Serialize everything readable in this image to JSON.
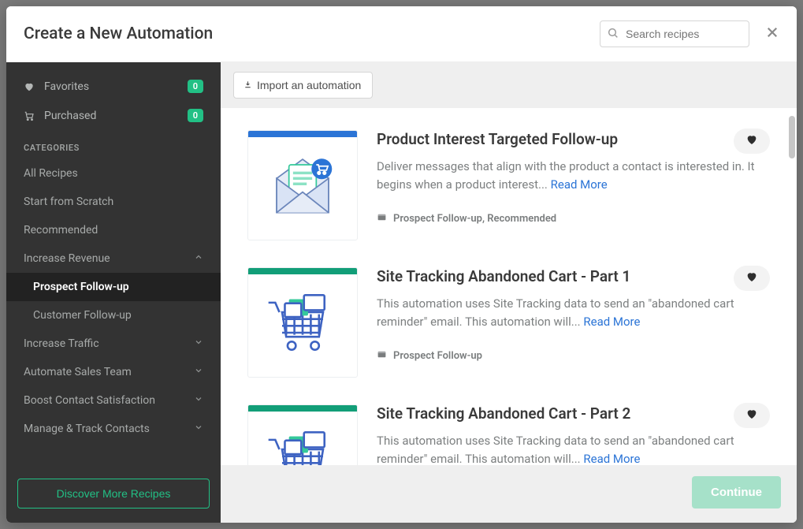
{
  "header": {
    "title": "Create a New Automation",
    "search_placeholder": "Search recipes"
  },
  "sidebar": {
    "top": [
      {
        "label": "Favorites",
        "badge": "0"
      },
      {
        "label": "Purchased",
        "badge": "0"
      }
    ],
    "section_label": "CATEGORIES",
    "categories": [
      {
        "label": "All Recipes"
      },
      {
        "label": "Start from Scratch"
      },
      {
        "label": "Recommended"
      },
      {
        "label": "Increase Revenue",
        "expanded": true,
        "children": [
          {
            "label": "Prospect Follow-up",
            "active": true
          },
          {
            "label": "Customer Follow-up"
          }
        ]
      },
      {
        "label": "Increase Traffic",
        "expandable": true
      },
      {
        "label": "Automate Sales Team",
        "expandable": true
      },
      {
        "label": "Boost Contact Satisfaction",
        "expandable": true
      },
      {
        "label": "Manage & Track Contacts",
        "expandable": true
      }
    ],
    "discover_label": "Discover More Recipes"
  },
  "toolbar": {
    "import_label": "Import an automation"
  },
  "recipes": [
    {
      "title": "Product Interest Targeted Follow-up",
      "description": "Deliver messages that align with the product a contact is interested in. It begins when a product interest... ",
      "read_more": "Read More",
      "meta": "Prospect Follow-up, Recommended",
      "accent": "#2b74d6",
      "art": "envelope"
    },
    {
      "title": "Site Tracking Abandoned Cart - Part 1",
      "description": "This automation uses Site Tracking data to send an \"abandoned cart reminder\" email. This automation will... ",
      "read_more": "Read More",
      "meta": "Prospect Follow-up",
      "accent": "#129e78",
      "art": "cart"
    },
    {
      "title": "Site Tracking Abandoned Cart - Part 2",
      "description": "This automation uses Site Tracking data to send an \"abandoned cart reminder\" email. This automation will... ",
      "read_more": "Read More",
      "meta": "",
      "accent": "#129e78",
      "art": "cart"
    }
  ],
  "footer": {
    "continue_label": "Continue"
  }
}
